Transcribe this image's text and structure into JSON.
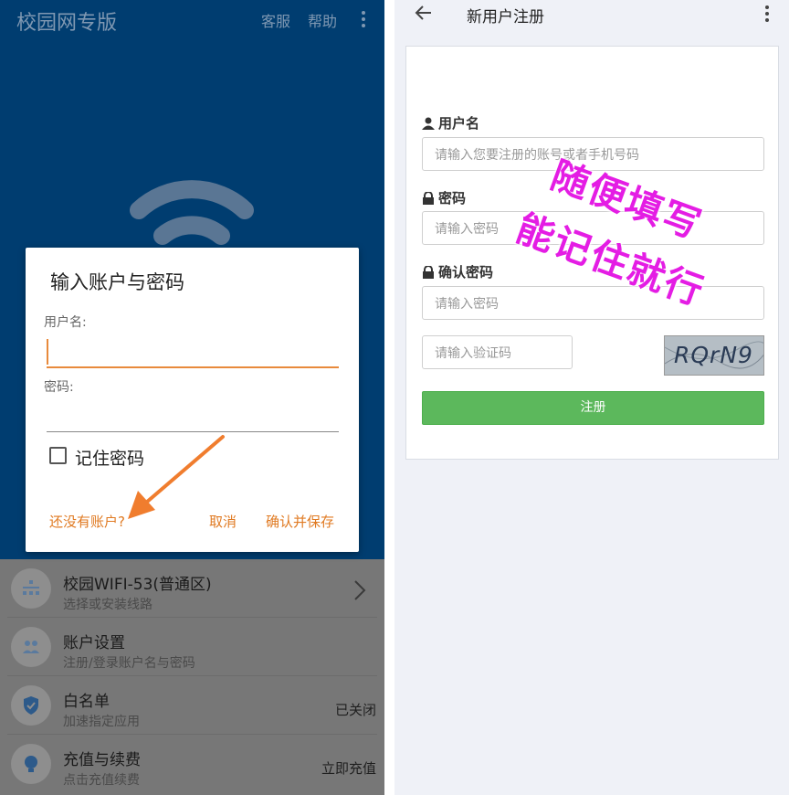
{
  "left": {
    "app_title": "校园网专版",
    "header_links": [
      "客服",
      "帮助"
    ],
    "menu_icon": "more-vertical-icon",
    "hero_icon": "wifi-icon",
    "list": [
      {
        "title": "校园WIFI-53(普通区)",
        "subtitle": "选择或安装线路",
        "right": "",
        "icon": "network-icon",
        "has_chevron": true
      },
      {
        "title": "账户设置",
        "subtitle": "注册/登录账户名与密码",
        "right": "",
        "icon": "users-icon"
      },
      {
        "title": "白名单",
        "subtitle": "加速指定应用",
        "right": "已关闭",
        "icon": "shield-icon"
      },
      {
        "title": "充值与续费",
        "subtitle": "点击充值续费",
        "right": "立即充值",
        "icon": "bulb-icon"
      }
    ],
    "dialog": {
      "title": "输入账户与密码",
      "username_label": "用户名:",
      "password_label": "密码:",
      "remember_label": "记住密码",
      "remember_checked": false,
      "no_account": "还没有账户?",
      "cancel": "取消",
      "confirm": "确认并保存"
    },
    "annotation_arrow_color": "#f07d2e"
  },
  "right": {
    "back_icon": "arrow-left-icon",
    "title": "新用户注册",
    "menu_icon": "more-vertical-icon",
    "form": {
      "username_label": "用户名",
      "username_placeholder": "请输入您要注册的账号或者手机号码",
      "password_label": "密码",
      "password_placeholder": "请输入密码",
      "confirm_label": "确认密码",
      "confirm_placeholder": "请输入密码",
      "captcha_placeholder": "请输入验证码",
      "captcha_text": "RQrN9",
      "submit_label": "注册"
    },
    "overlay_line1": "随便填写",
    "overlay_line2": "能记住就行",
    "overlay_color": "#e41de4"
  },
  "colors": {
    "hero_blue": "#003d70",
    "accent_orange": "#e07a22",
    "submit_green": "#5cb85c"
  }
}
